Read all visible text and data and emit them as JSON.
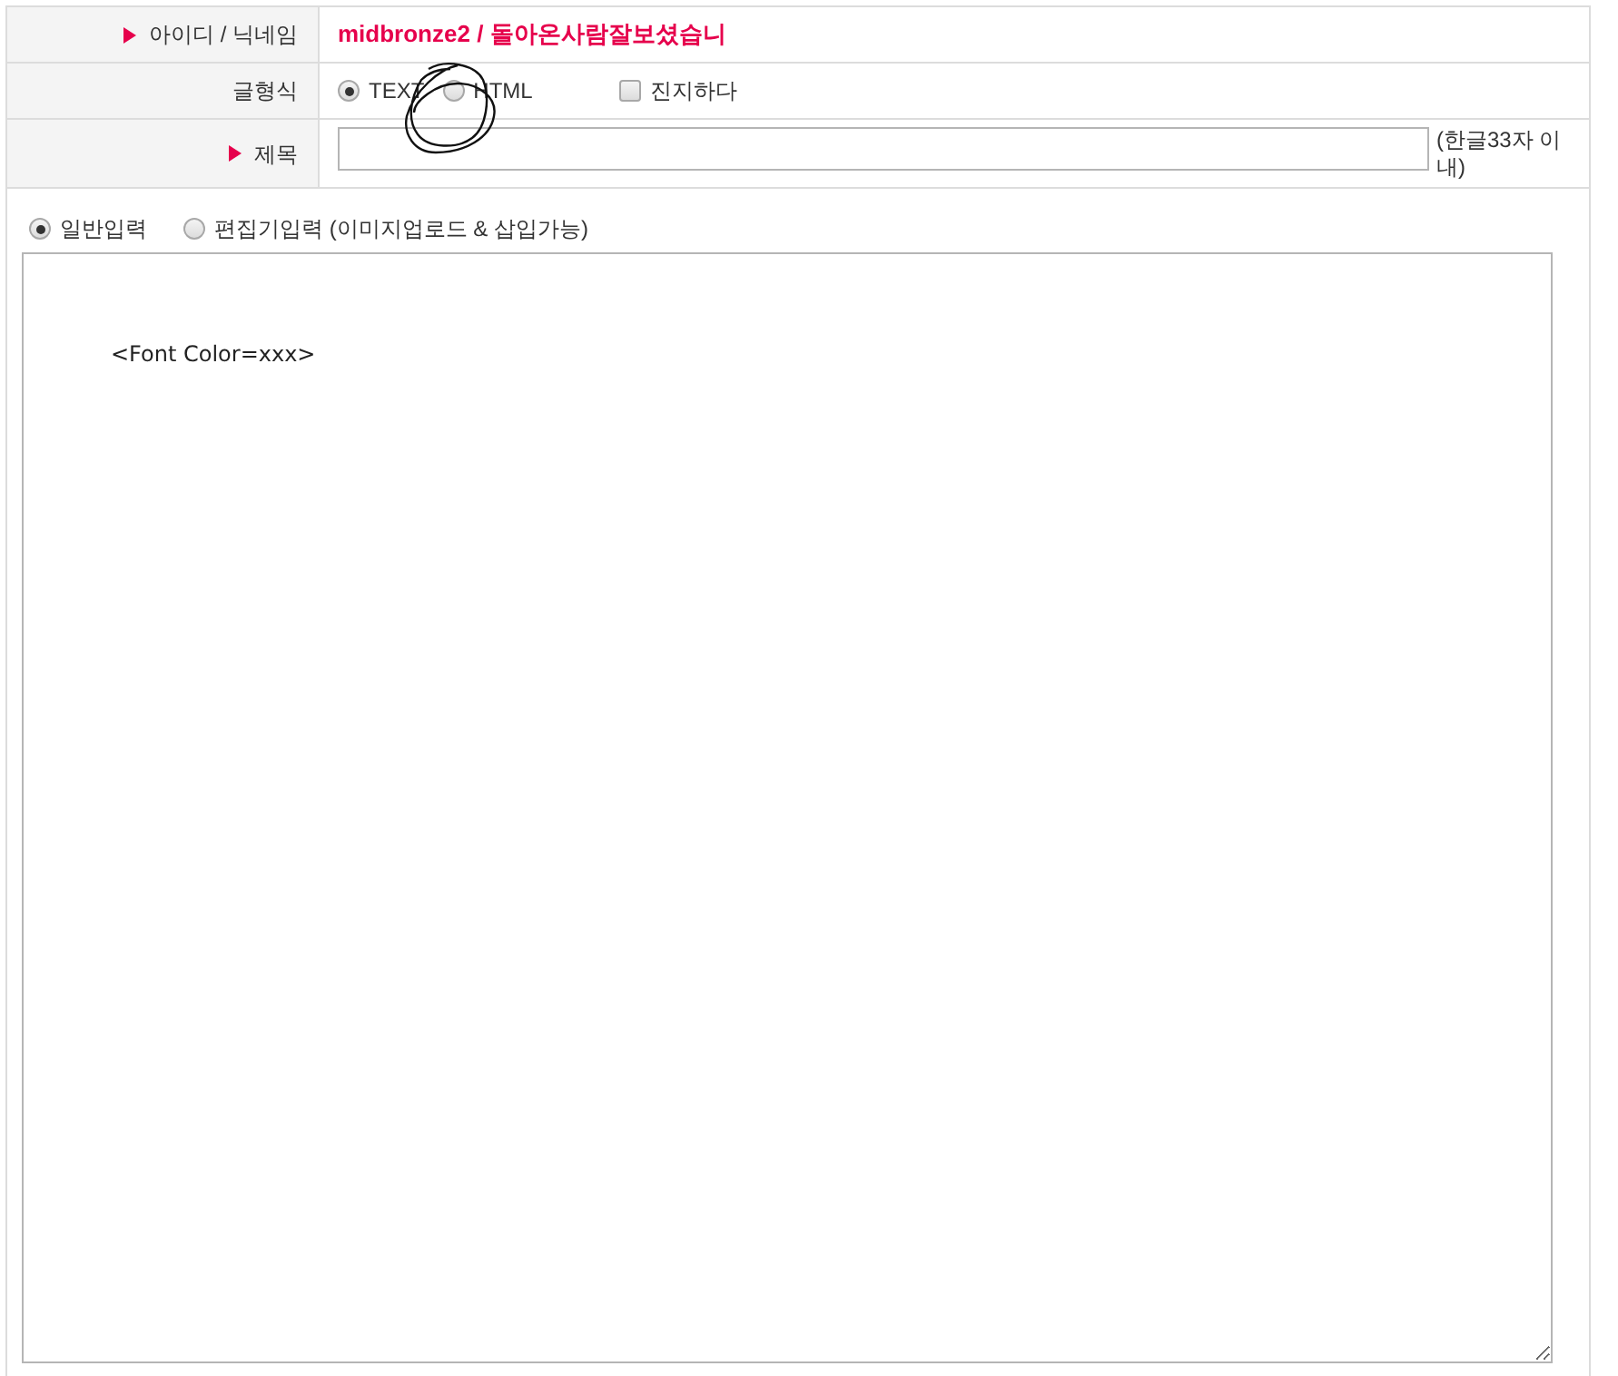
{
  "form": {
    "rows": [
      {
        "kind": "author",
        "label": "아이디 / 닉네임",
        "marker": true,
        "value": "midbronze2 / 돌아온사람잘보셨습니"
      },
      {
        "kind": "format",
        "label": "글형식",
        "marker": false,
        "options": [
          {
            "label": "TEXT",
            "selected": true
          },
          {
            "label": "HTML",
            "selected": false
          }
        ],
        "checkbox": {
          "label": "진지하다",
          "checked": false
        }
      },
      {
        "kind": "title",
        "label": "제목",
        "marker": true,
        "note": "(한글33자 이내)"
      }
    ]
  },
  "editor": {
    "modes": [
      {
        "label": "일반입력",
        "selected": true
      },
      {
        "label": "편집기입력 (이미지업로드 & 삽입가능)",
        "selected": false
      }
    ],
    "content": "<Font Color=xxx>"
  }
}
